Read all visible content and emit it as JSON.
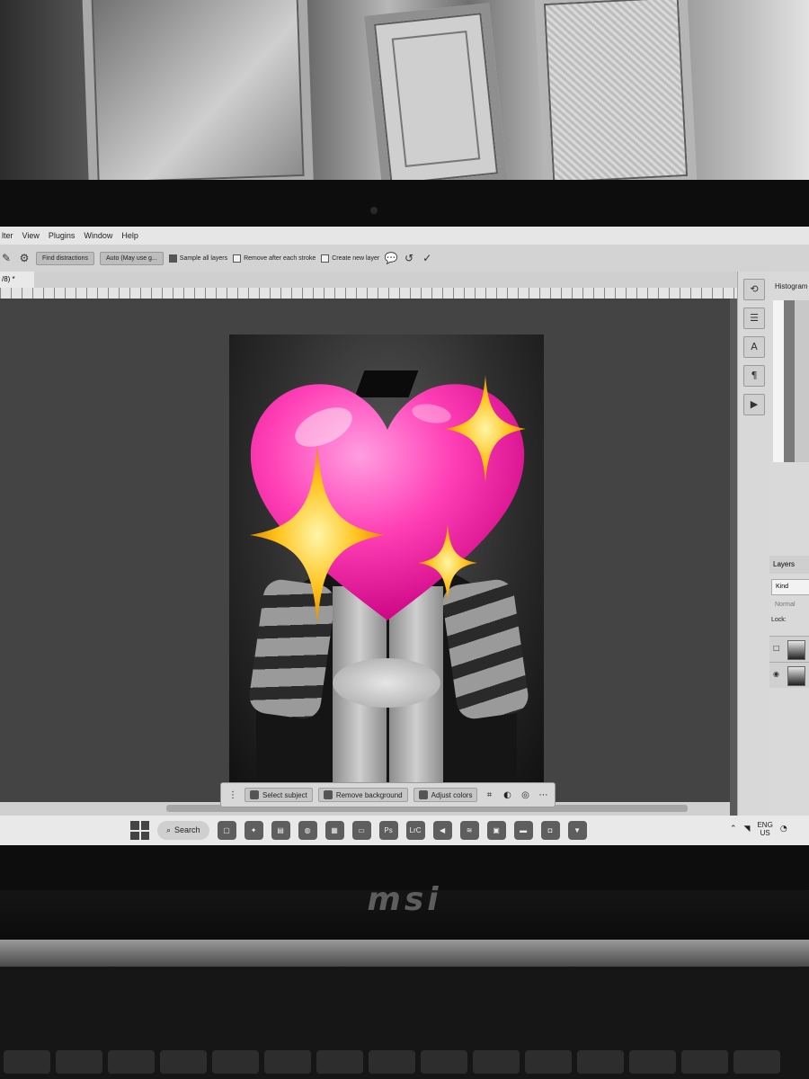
{
  "menubar": {
    "items": [
      "lter",
      "View",
      "Plugins",
      "Window",
      "Help"
    ]
  },
  "options_bar": {
    "find_button": "Find distractions",
    "mode_select": "Auto (May use g...",
    "sample_all_layers": "Sample all layers",
    "remove_after_stroke": "Remove after each stroke",
    "create_new_layer": "Create new layer",
    "sample_all_checked": true
  },
  "document_tab": {
    "label": "/8) *"
  },
  "contextual_bar": {
    "select_subject": "Select subject",
    "remove_background": "Remove background",
    "adjust_colors": "Adjust colors"
  },
  "right_panel": {
    "histogram_label": "Histogram",
    "layers_label": "Layers",
    "kind_label": "Kind",
    "blend_mode": "Normal",
    "lock_label": "Lock:"
  },
  "taskbar": {
    "search_label": "Search",
    "app_labels": [
      "Ps",
      "LrC"
    ],
    "lang_top": "ENG",
    "lang_bottom": "US"
  },
  "laptop": {
    "brand": "msi"
  },
  "colors": {
    "heart_pink": "#ff3fb6",
    "sparkle_gold": "#ffc21a",
    "ui_light": "#d8d8d8",
    "canvas_gray": "#444444"
  }
}
